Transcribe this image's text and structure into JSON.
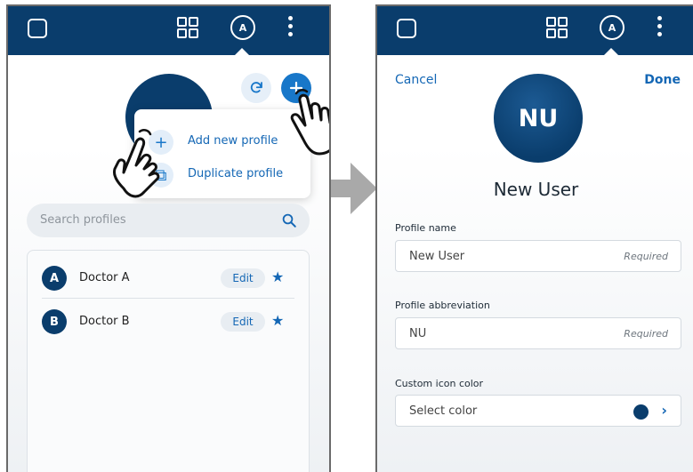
{
  "left_screen": {
    "topbar": {
      "app_icon": "square-icon",
      "grid_icon": "grid-icon",
      "avatar_letter": "A",
      "menu_icon": "kebab-icon"
    },
    "actions": {
      "refresh_icon": "refresh-icon",
      "add_icon": "plus-icon"
    },
    "popup_menu": {
      "items": [
        {
          "label": "Add new profile",
          "icon": "plus-icon"
        },
        {
          "label": "Duplicate profile",
          "icon": "copy-icon"
        }
      ]
    },
    "search": {
      "placeholder": "Search profiles",
      "icon": "search-icon"
    },
    "profiles": [
      {
        "initial": "A",
        "name": "Doctor A",
        "edit_label": "Edit",
        "favorite": true
      },
      {
        "initial": "B",
        "name": "Doctor B",
        "edit_label": "Edit",
        "favorite": true
      }
    ]
  },
  "right_screen": {
    "topbar": {
      "app_icon": "square-icon",
      "grid_icon": "grid-icon",
      "avatar_letter": "A",
      "menu_icon": "kebab-icon"
    },
    "cancel_label": "Cancel",
    "done_label": "Done",
    "avatar_initials": "NU",
    "title": "New User",
    "fields": {
      "profile_name": {
        "label": "Profile name",
        "value": "New User",
        "hint": "Required"
      },
      "profile_abbreviation": {
        "label": "Profile abbreviation",
        "value": "NU",
        "hint": "Required"
      },
      "custom_icon_color": {
        "label": "Custom icon color",
        "value": "Select color",
        "color": "#0a3d6c"
      }
    }
  },
  "colors": {
    "brand_navy": "#0a3d6c",
    "accent_blue": "#1877c9",
    "link_blue": "#1467b5"
  }
}
